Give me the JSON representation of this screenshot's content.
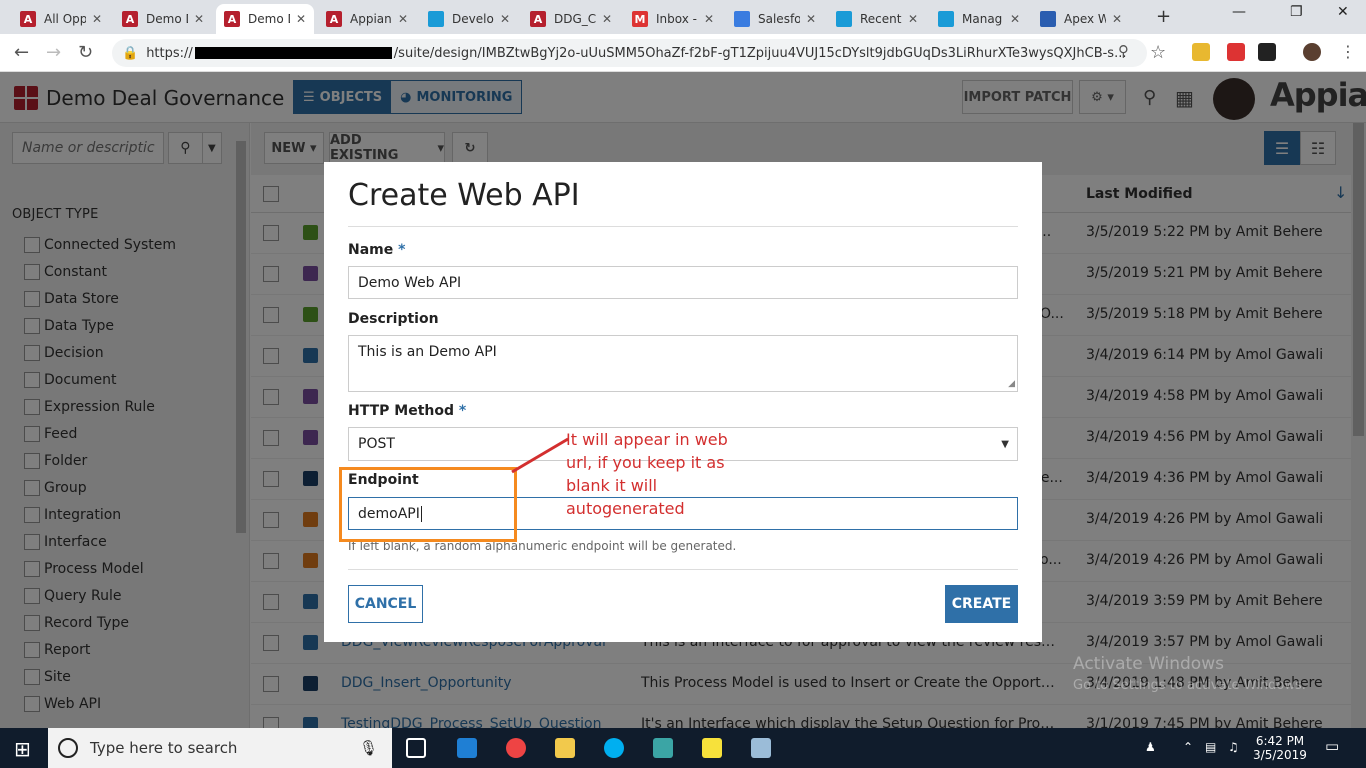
{
  "browser": {
    "tabs": [
      {
        "title": "All Opp",
        "active": false
      },
      {
        "title": "Demo D",
        "active": false
      },
      {
        "title": "Demo D",
        "active": true
      },
      {
        "title": "Appian",
        "active": false
      },
      {
        "title": "Develo",
        "active": false
      },
      {
        "title": "DDG_C",
        "active": false
      },
      {
        "title": "Inbox -",
        "active": false
      },
      {
        "title": "Salesfo",
        "active": false
      },
      {
        "title": "Recent",
        "active": false
      },
      {
        "title": "Manag",
        "active": false
      },
      {
        "title": "Apex W",
        "active": false
      }
    ],
    "url_prefix": "https://",
    "url_suffix": "/suite/design/IMBZtwBgYj2o-uUuSMM5OhaZf-f2bF-gT1Zpijuu4VUJ15cDYslt9jdbGUqDs3LiRhurXTe3wysQXJhCB-s..."
  },
  "header": {
    "app_title": "Demo Deal Governance",
    "objects_label": "OBJECTS",
    "monitoring_label": "MONITORING",
    "import_patch_label": "IMPORT PATCH",
    "brand": "Appian"
  },
  "sidebar": {
    "search_placeholder": "Name or descriptic",
    "section_title": "OBJECT TYPE",
    "filters": [
      "Connected System",
      "Constant",
      "Data Store",
      "Data Type",
      "Decision",
      "Document",
      "Expression Rule",
      "Feed",
      "Folder",
      "Group",
      "Integration",
      "Interface",
      "Process Model",
      "Query Rule",
      "Record Type",
      "Report",
      "Site",
      "Web API"
    ]
  },
  "toolbar": {
    "new_label": "NEW",
    "add_existing_label": "ADD EXISTING"
  },
  "grid": {
    "col_last_modified": "Last Modified",
    "rows": [
      {
        "name": "",
        "desc": "",
        "tail": "l t...",
        "modified": "3/5/2019 5:22 PM by Amit Behere",
        "icon_color": "#5aa02c"
      },
      {
        "name": "",
        "desc": "",
        "tail": "",
        "modified": "3/5/2019 5:21 PM by Amit Behere",
        "icon_color": "#7b4fa0"
      },
      {
        "name": "",
        "desc": "",
        "tail": "O...",
        "modified": "3/5/2019 5:18 PM by Amit Behere",
        "icon_color": "#5aa02c"
      },
      {
        "name": "",
        "desc": "",
        "tail": "",
        "modified": "3/4/2019 6:14 PM by Amol Gawali",
        "icon_color": "#2f70a8"
      },
      {
        "name": "",
        "desc": "",
        "tail": "",
        "modified": "3/4/2019 4:58 PM by Amol Gawali",
        "icon_color": "#7b4fa0"
      },
      {
        "name": "",
        "desc": "",
        "tail": "",
        "modified": "3/4/2019 4:56 PM by Amol Gawali",
        "icon_color": "#7b4fa0"
      },
      {
        "name": "",
        "desc": "",
        "tail": "he...",
        "modified": "3/4/2019 4:36 PM by Amol Gawali",
        "icon_color": "#1a3f66"
      },
      {
        "name": "",
        "desc": "",
        "tail": "",
        "modified": "3/4/2019 4:26 PM by Amol Gawali",
        "icon_color": "#e07a1f"
      },
      {
        "name": "",
        "desc": "",
        "tail": "o...",
        "modified": "3/4/2019 4:26 PM by Amol Gawali",
        "icon_color": "#e07a1f"
      },
      {
        "name": "",
        "desc": "",
        "tail": "",
        "modified": "3/4/2019 3:59 PM by Amit Behere",
        "icon_color": "#2f70a8"
      },
      {
        "name": "DDG_ViewReviewResposeForApproval",
        "desc": "This is an interface to for approval to view the review response ...",
        "tail": "",
        "modified": "3/4/2019 3:57 PM by Amol Gawali",
        "icon_color": "#2f70a8"
      },
      {
        "name": "DDG_Insert_Opportunity",
        "desc": "This Process Model is used to Insert or Create the Opportunity",
        "tail": "",
        "modified": "3/4/2019 1:48 PM by Amit Behere",
        "icon_color": "#1a3f66"
      },
      {
        "name": "TestingDDG_Process_SetUp_Question",
        "desc": "It's an Interface which display the Setup Question for Processin...",
        "tail": "",
        "modified": "3/1/2019 7:45 PM by Amit Behere",
        "icon_color": "#2f70a8"
      }
    ]
  },
  "modal": {
    "title": "Create Web API",
    "name_label": "Name",
    "name_value": "Demo Web API",
    "description_label": "Description",
    "description_value": "This is an Demo API",
    "method_label": "HTTP Method",
    "method_value": "POST",
    "endpoint_label": "Endpoint",
    "endpoint_value": "demoAPI",
    "endpoint_hint": "If left blank, a random alphanumeric endpoint will be generated.",
    "cancel_label": "CANCEL",
    "create_label": "CREATE",
    "required_mark": "*"
  },
  "annotation": {
    "text": "It will appear in web url, if you keep it as blank it will autogenerated"
  },
  "watermark": {
    "line1": "Activate Windows",
    "line2": "Go to Settings to activate Windows."
  },
  "taskbar": {
    "search_placeholder": "Type here to search",
    "time": "6:42 PM",
    "date": "3/5/2019"
  }
}
